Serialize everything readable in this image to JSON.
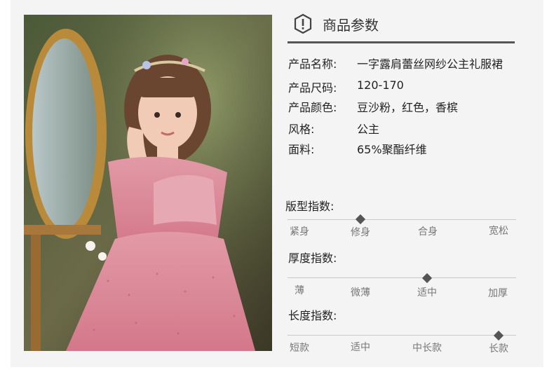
{
  "header": {
    "title": "商品参数",
    "icon": "warning-hexagon-icon"
  },
  "params": [
    {
      "label": "产品名称:",
      "value": "一字露肩蕾丝网纱公主礼服裙"
    },
    {
      "label": "产品尺码:",
      "value": "120-170"
    },
    {
      "label": "产品颜色:",
      "value": "豆沙粉，红色，香槟"
    },
    {
      "label": "风格:",
      "value": "公主"
    },
    {
      "label": "面料:",
      "value": "65%聚酯纤维"
    }
  ],
  "indices": [
    {
      "title": "版型指数:",
      "labels": [
        "紧身",
        "修身",
        "合身",
        "宽松"
      ],
      "selected_index": 1
    },
    {
      "title": "厚度指数:",
      "labels": [
        "薄",
        "微薄",
        "适中",
        "加厚"
      ],
      "selected_index": 2
    },
    {
      "title": "长度指数:",
      "labels": [
        "短款",
        "适中",
        "中长款",
        "长款"
      ],
      "selected_index": 3
    }
  ],
  "colors": {
    "panel_bg": "#f4f4f4",
    "marker": "#555555",
    "scale_line": "#c8c8c8",
    "dress_pink": "#d97f8f"
  },
  "image": {
    "subject": "product photo"
  }
}
